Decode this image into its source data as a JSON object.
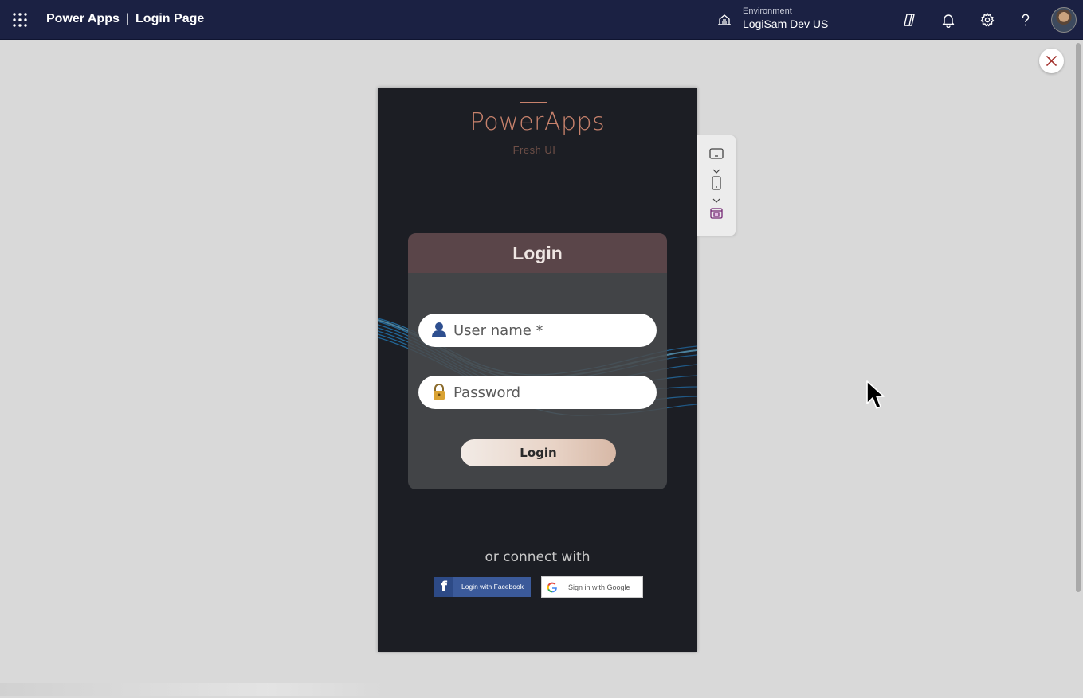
{
  "header": {
    "app_name": "Power Apps",
    "separator": "|",
    "page_name": "Login Page",
    "environment_label": "Environment",
    "environment_name": "LogiSam Dev US"
  },
  "phone": {
    "brand_name": "PowerApps",
    "brand_subtitle": "Fresh UI",
    "login_card": {
      "title": "Login",
      "username_placeholder": "User name *",
      "password_placeholder": "Password",
      "login_button": "Login"
    },
    "connect_text": "or connect with",
    "facebook_button": "Login with Facebook",
    "google_button": "Sign in with Google"
  },
  "colors": {
    "topbar": "#1b2143",
    "canvas": "#d9d9d9",
    "phone_bg": "#1c1e24",
    "brand_accent": "#c8826c",
    "card_header": "#5a4549",
    "facebook": "#3b5a9a"
  },
  "icons": {
    "app_launcher": "waffle-icon",
    "environment": "environment-icon",
    "copilot": "copilot-icon",
    "notifications": "bell-icon",
    "settings": "gear-icon",
    "help": "help-icon",
    "close": "close-icon",
    "user": "user-icon",
    "lock": "lock-icon"
  }
}
